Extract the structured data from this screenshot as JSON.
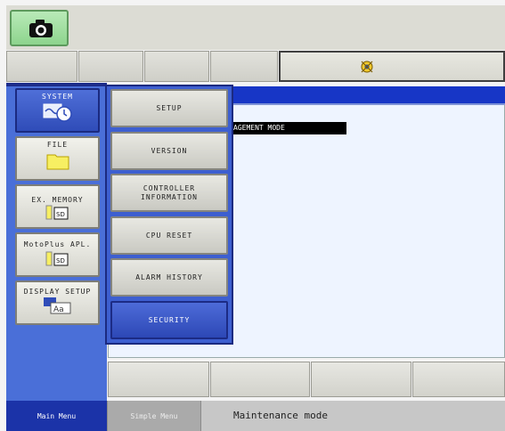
{
  "left_menu": [
    {
      "label": "SYSTEM",
      "icon": "system-clock-icon",
      "active": true
    },
    {
      "label": "FILE",
      "icon": "folder-icon"
    },
    {
      "label": "EX. MEMORY",
      "icon": "sd-card-icon"
    },
    {
      "label": "MotoPlus APL.",
      "icon": "sd-card-icon"
    },
    {
      "label": "DISPLAY SETUP",
      "icon": "display-font-icon"
    }
  ],
  "submenu": [
    {
      "label": "SETUP"
    },
    {
      "label": "VERSION"
    },
    {
      "label": "CONTROLLER\nINFORMATION"
    },
    {
      "label": "CPU RESET"
    },
    {
      "label": "ALARM HISTORY"
    },
    {
      "label": "SECURITY",
      "active": true
    }
  ],
  "content": {
    "mode_banner": "AGEMENT MODE"
  },
  "sd_label": "SD",
  "font_icon_label": "Aa",
  "status_bar": {
    "main_menu": "Main Menu",
    "simple_menu": "Simple Menu",
    "status_text": "Maintenance mode"
  },
  "colors": {
    "menu_blue": "#1b33a8",
    "active_button": "#2f4cb8",
    "camera_green": "#8dd48d"
  }
}
